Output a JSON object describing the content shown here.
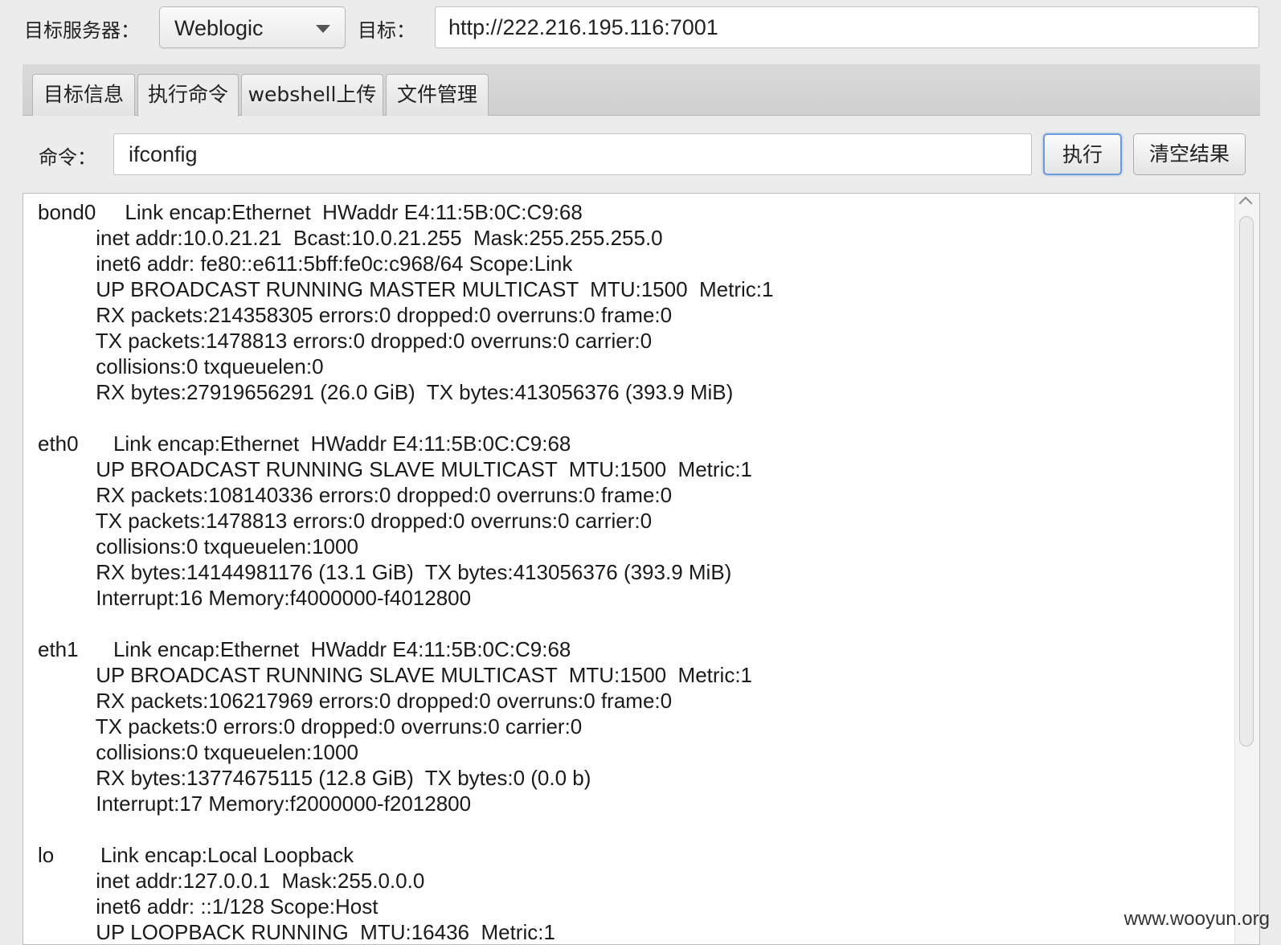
{
  "header": {
    "server_label": "目标服务器：",
    "server_selected": "Weblogic",
    "target_label": "目标：",
    "target_value": "http://222.216.195.116:7001"
  },
  "tabs": [
    {
      "label": "目标信息",
      "active": false
    },
    {
      "label": "执行命令",
      "active": true
    },
    {
      "label": "webshell上传",
      "active": false
    },
    {
      "label": "文件管理",
      "active": false
    }
  ],
  "command": {
    "label": "命令：",
    "value": "ifconfig",
    "execute_label": "执行",
    "clear_label": "清空结果"
  },
  "output": {
    "lines": [
      "bond0     Link encap:Ethernet  HWaddr E4:11:5B:0C:C9:68",
      "          inet addr:10.0.21.21  Bcast:10.0.21.255  Mask:255.255.255.0",
      "          inet6 addr: fe80::e611:5bff:fe0c:c968/64 Scope:Link",
      "          UP BROADCAST RUNNING MASTER MULTICAST  MTU:1500  Metric:1",
      "          RX packets:214358305 errors:0 dropped:0 overruns:0 frame:0",
      "          TX packets:1478813 errors:0 dropped:0 overruns:0 carrier:0",
      "          collisions:0 txqueuelen:0",
      "          RX bytes:27919656291 (26.0 GiB)  TX bytes:413056376 (393.9 MiB)",
      "",
      "eth0      Link encap:Ethernet  HWaddr E4:11:5B:0C:C9:68",
      "          UP BROADCAST RUNNING SLAVE MULTICAST  MTU:1500  Metric:1",
      "          RX packets:108140336 errors:0 dropped:0 overruns:0 frame:0",
      "          TX packets:1478813 errors:0 dropped:0 overruns:0 carrier:0",
      "          collisions:0 txqueuelen:1000",
      "          RX bytes:14144981176 (13.1 GiB)  TX bytes:413056376 (393.9 MiB)",
      "          Interrupt:16 Memory:f4000000-f4012800",
      "",
      "eth1      Link encap:Ethernet  HWaddr E4:11:5B:0C:C9:68",
      "          UP BROADCAST RUNNING SLAVE MULTICAST  MTU:1500  Metric:1",
      "          RX packets:106217969 errors:0 dropped:0 overruns:0 frame:0",
      "          TX packets:0 errors:0 dropped:0 overruns:0 carrier:0",
      "          collisions:0 txqueuelen:1000",
      "          RX bytes:13774675115 (12.8 GiB)  TX bytes:0 (0.0 b)",
      "          Interrupt:17 Memory:f2000000-f2012800",
      "",
      "lo        Link encap:Local Loopback",
      "          inet addr:127.0.0.1  Mask:255.0.0.0",
      "          inet6 addr: ::1/128 Scope:Host",
      "          UP LOOPBACK RUNNING  MTU:16436  Metric:1"
    ]
  },
  "watermark": "www.wooyun.org",
  "colors": {
    "focus_border": "#6b9bd8",
    "window_bg": "#ececec"
  }
}
